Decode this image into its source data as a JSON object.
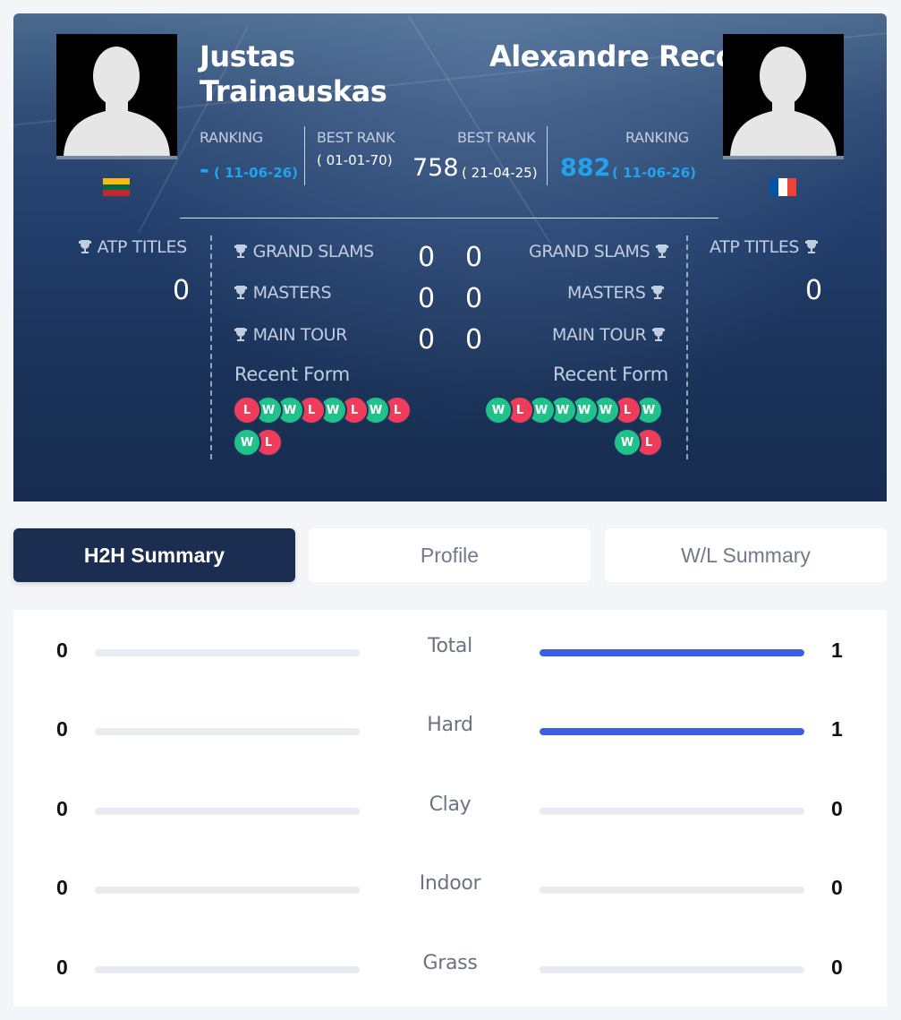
{
  "player1": {
    "name_line1": "Justas",
    "name_line2": "Trainauskas",
    "ranking_label": "RANKING",
    "ranking_value": "-",
    "ranking_date": "( 11-06-26)",
    "best_rank_label": "BEST RANK",
    "best_rank_date": "( 01-01-70)",
    "country": "Lithuania",
    "atp_titles_label": "ATP TITLES",
    "atp_titles": "0",
    "recent_form": [
      "L",
      "W",
      "W",
      "L",
      "W",
      "L",
      "W",
      "L",
      "W",
      "L"
    ]
  },
  "player2": {
    "name": "Alexandre Reco",
    "ranking_label": "RANKING",
    "ranking_value": "882",
    "ranking_date": "( 11-06-26)",
    "best_rank_label": "BEST RANK",
    "best_rank_value": "758",
    "best_rank_date": "( 21-04-25)",
    "country": "France",
    "atp_titles_label": "ATP TITLES",
    "atp_titles": "0",
    "recent_form": [
      "W",
      "L",
      "W",
      "W",
      "W",
      "W",
      "L",
      "W",
      "W",
      "L"
    ]
  },
  "titles": [
    {
      "label": "GRAND SLAMS",
      "p1": "0",
      "p2": "0"
    },
    {
      "label": "MASTERS",
      "p1": "0",
      "p2": "0"
    },
    {
      "label": "MAIN TOUR",
      "p1": "0",
      "p2": "0"
    }
  ],
  "recent_form_label": "Recent Form",
  "tabs": [
    {
      "label": "H2H Summary",
      "active": true
    },
    {
      "label": "Profile",
      "active": false
    },
    {
      "label": "W/L Summary",
      "active": false
    }
  ],
  "summary": [
    {
      "label": "Total",
      "p1": "0",
      "p2": "1",
      "p1_fill": 0,
      "p2_fill": 1
    },
    {
      "label": "Hard",
      "p1": "0",
      "p2": "1",
      "p1_fill": 0,
      "p2_fill": 1
    },
    {
      "label": "Clay",
      "p1": "0",
      "p2": "0",
      "p1_fill": 0,
      "p2_fill": 0
    },
    {
      "label": "Indoor",
      "p1": "0",
      "p2": "0",
      "p1_fill": 0,
      "p2_fill": 0
    },
    {
      "label": "Grass",
      "p1": "0",
      "p2": "0",
      "p1_fill": 0,
      "p2_fill": 0
    }
  ],
  "colors": {
    "win": "#20c28a",
    "loss": "#ee3d5b",
    "rank_blue": "#22a3ef",
    "bar_fill": "#3a5fe6",
    "active_tab": "#1b2e52"
  }
}
